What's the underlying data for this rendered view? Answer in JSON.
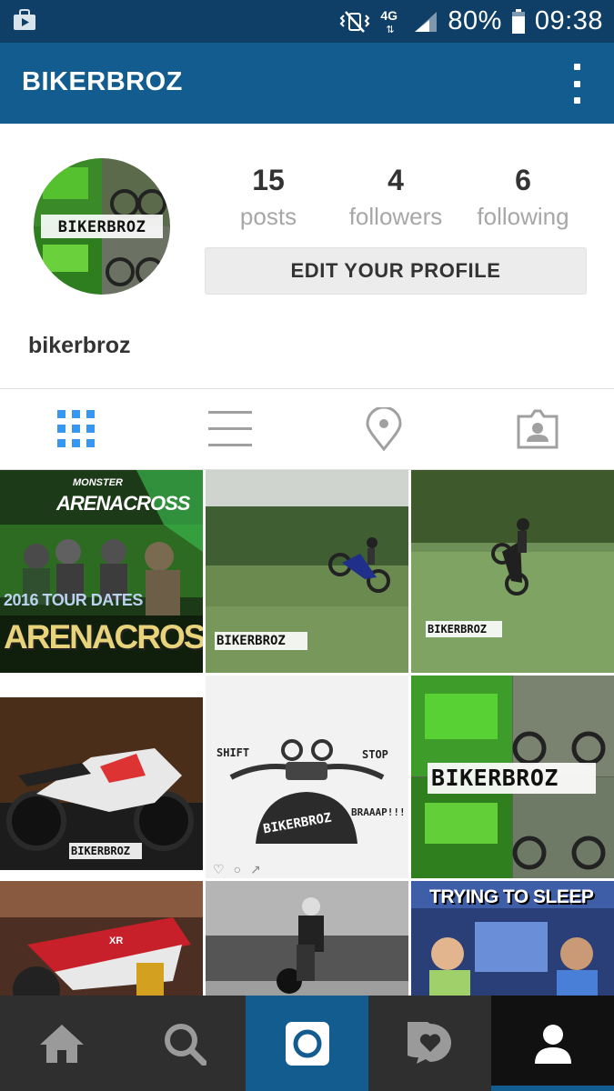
{
  "status_bar": {
    "battery_percent": "80%",
    "time": "09:38",
    "network": "4G"
  },
  "app_bar": {
    "title": "BIKERBROZ"
  },
  "profile": {
    "stats": [
      {
        "value": "15",
        "label": "posts"
      },
      {
        "value": "4",
        "label": "followers"
      },
      {
        "value": "6",
        "label": "following"
      }
    ],
    "edit_button_label": "EDIT YOUR PROFILE",
    "username": "bikerbroz",
    "avatar_text": "BIKERBROZ"
  },
  "tabs": [
    {
      "name": "grid-view",
      "icon": "grid-icon",
      "active": true
    },
    {
      "name": "list-view",
      "icon": "list-icon",
      "active": false
    },
    {
      "name": "map-view",
      "icon": "location-pin-icon",
      "active": false
    },
    {
      "name": "tagged-view",
      "icon": "tagged-person-icon",
      "active": false
    }
  ],
  "grid": {
    "posts": [
      {
        "kind": "arena-cross-poster",
        "line1": "MONSTER",
        "line2": "ARENACROSS",
        "line3": "2016 TOUR DATES",
        "line4": "ARENACROSS"
      },
      {
        "kind": "wheelie-field",
        "caption": "BIKERBROZ"
      },
      {
        "kind": "wheelie-field-2",
        "caption": "BIKERBROZ"
      },
      {
        "kind": "night-bike",
        "caption": "BIKERBROZ"
      },
      {
        "kind": "handlebar-logo",
        "left_note": "SHIFT",
        "right_note": "STOP",
        "sound": "BRAAAP!!!",
        "tank_text": "BIKERBROZ"
      },
      {
        "kind": "collage",
        "caption": "BIKERBROZ"
      },
      {
        "kind": "red-bike",
        "badge": "XR"
      },
      {
        "kind": "bw-rider"
      },
      {
        "kind": "meme",
        "caption": "TRYING TO SLEEP"
      }
    ]
  },
  "bottom_nav": [
    {
      "name": "home",
      "icon": "home-icon"
    },
    {
      "name": "search",
      "icon": "search-icon"
    },
    {
      "name": "camera",
      "icon": "camera-icon"
    },
    {
      "name": "activity",
      "icon": "activity-heart-icon"
    },
    {
      "name": "profile",
      "icon": "profile-icon"
    }
  ],
  "colors": {
    "app_bar": "#135c8f",
    "status_bar": "#0f3f66",
    "tab_active": "#3897f0",
    "tab_inactive": "#a0a0a0"
  }
}
